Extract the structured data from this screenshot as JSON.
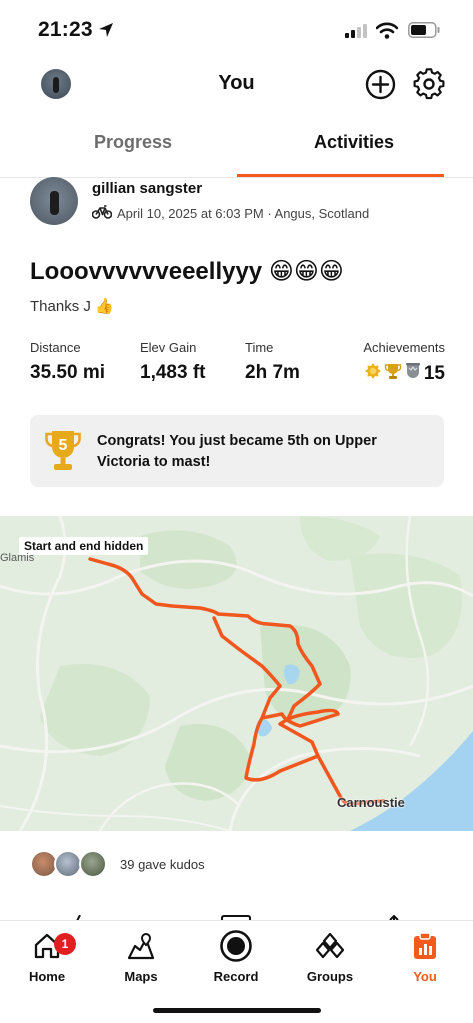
{
  "status": {
    "time": "21:23",
    "icons": [
      "location-arrow-icon",
      "signal-icon",
      "wifi-icon",
      "battery-icon"
    ]
  },
  "header": {
    "title": "You",
    "icons": [
      "avatar",
      "add-circle-icon",
      "gear-icon"
    ]
  },
  "tabs": {
    "progress": "Progress",
    "activities": "Activities",
    "active": "activities",
    "accent": "#f25b1c"
  },
  "activity": {
    "athlete": "gillian sangster",
    "meta": "April 10, 2025 at 6:03 PM · Angus, Scotland",
    "title": "Looovvvvvveeellyyy 😁😁😁",
    "description": "Thanks J 👍",
    "stats": {
      "distance_label": "Distance",
      "distance_value": "35.50 mi",
      "elev_label": "Elev Gain",
      "elev_value": "1,483 ft",
      "time_label": "Time",
      "time_value": "2h 7m",
      "ach_label": "Achievements",
      "ach_value": "15"
    },
    "congrats": "Congrats! You just became 5th on Upper Victoria to mast!",
    "congrats_rank": "5"
  },
  "map": {
    "start_label": "Start and end hidden",
    "place_glamis": "Glamis",
    "place_carnoustie": "Carnoustie",
    "route_color": "#f0561d"
  },
  "kudos": {
    "text": "39 gave kudos"
  },
  "tabbar": {
    "home": "Home",
    "home_badge": "1",
    "maps": "Maps",
    "record": "Record",
    "groups": "Groups",
    "you": "You",
    "active": "you"
  }
}
